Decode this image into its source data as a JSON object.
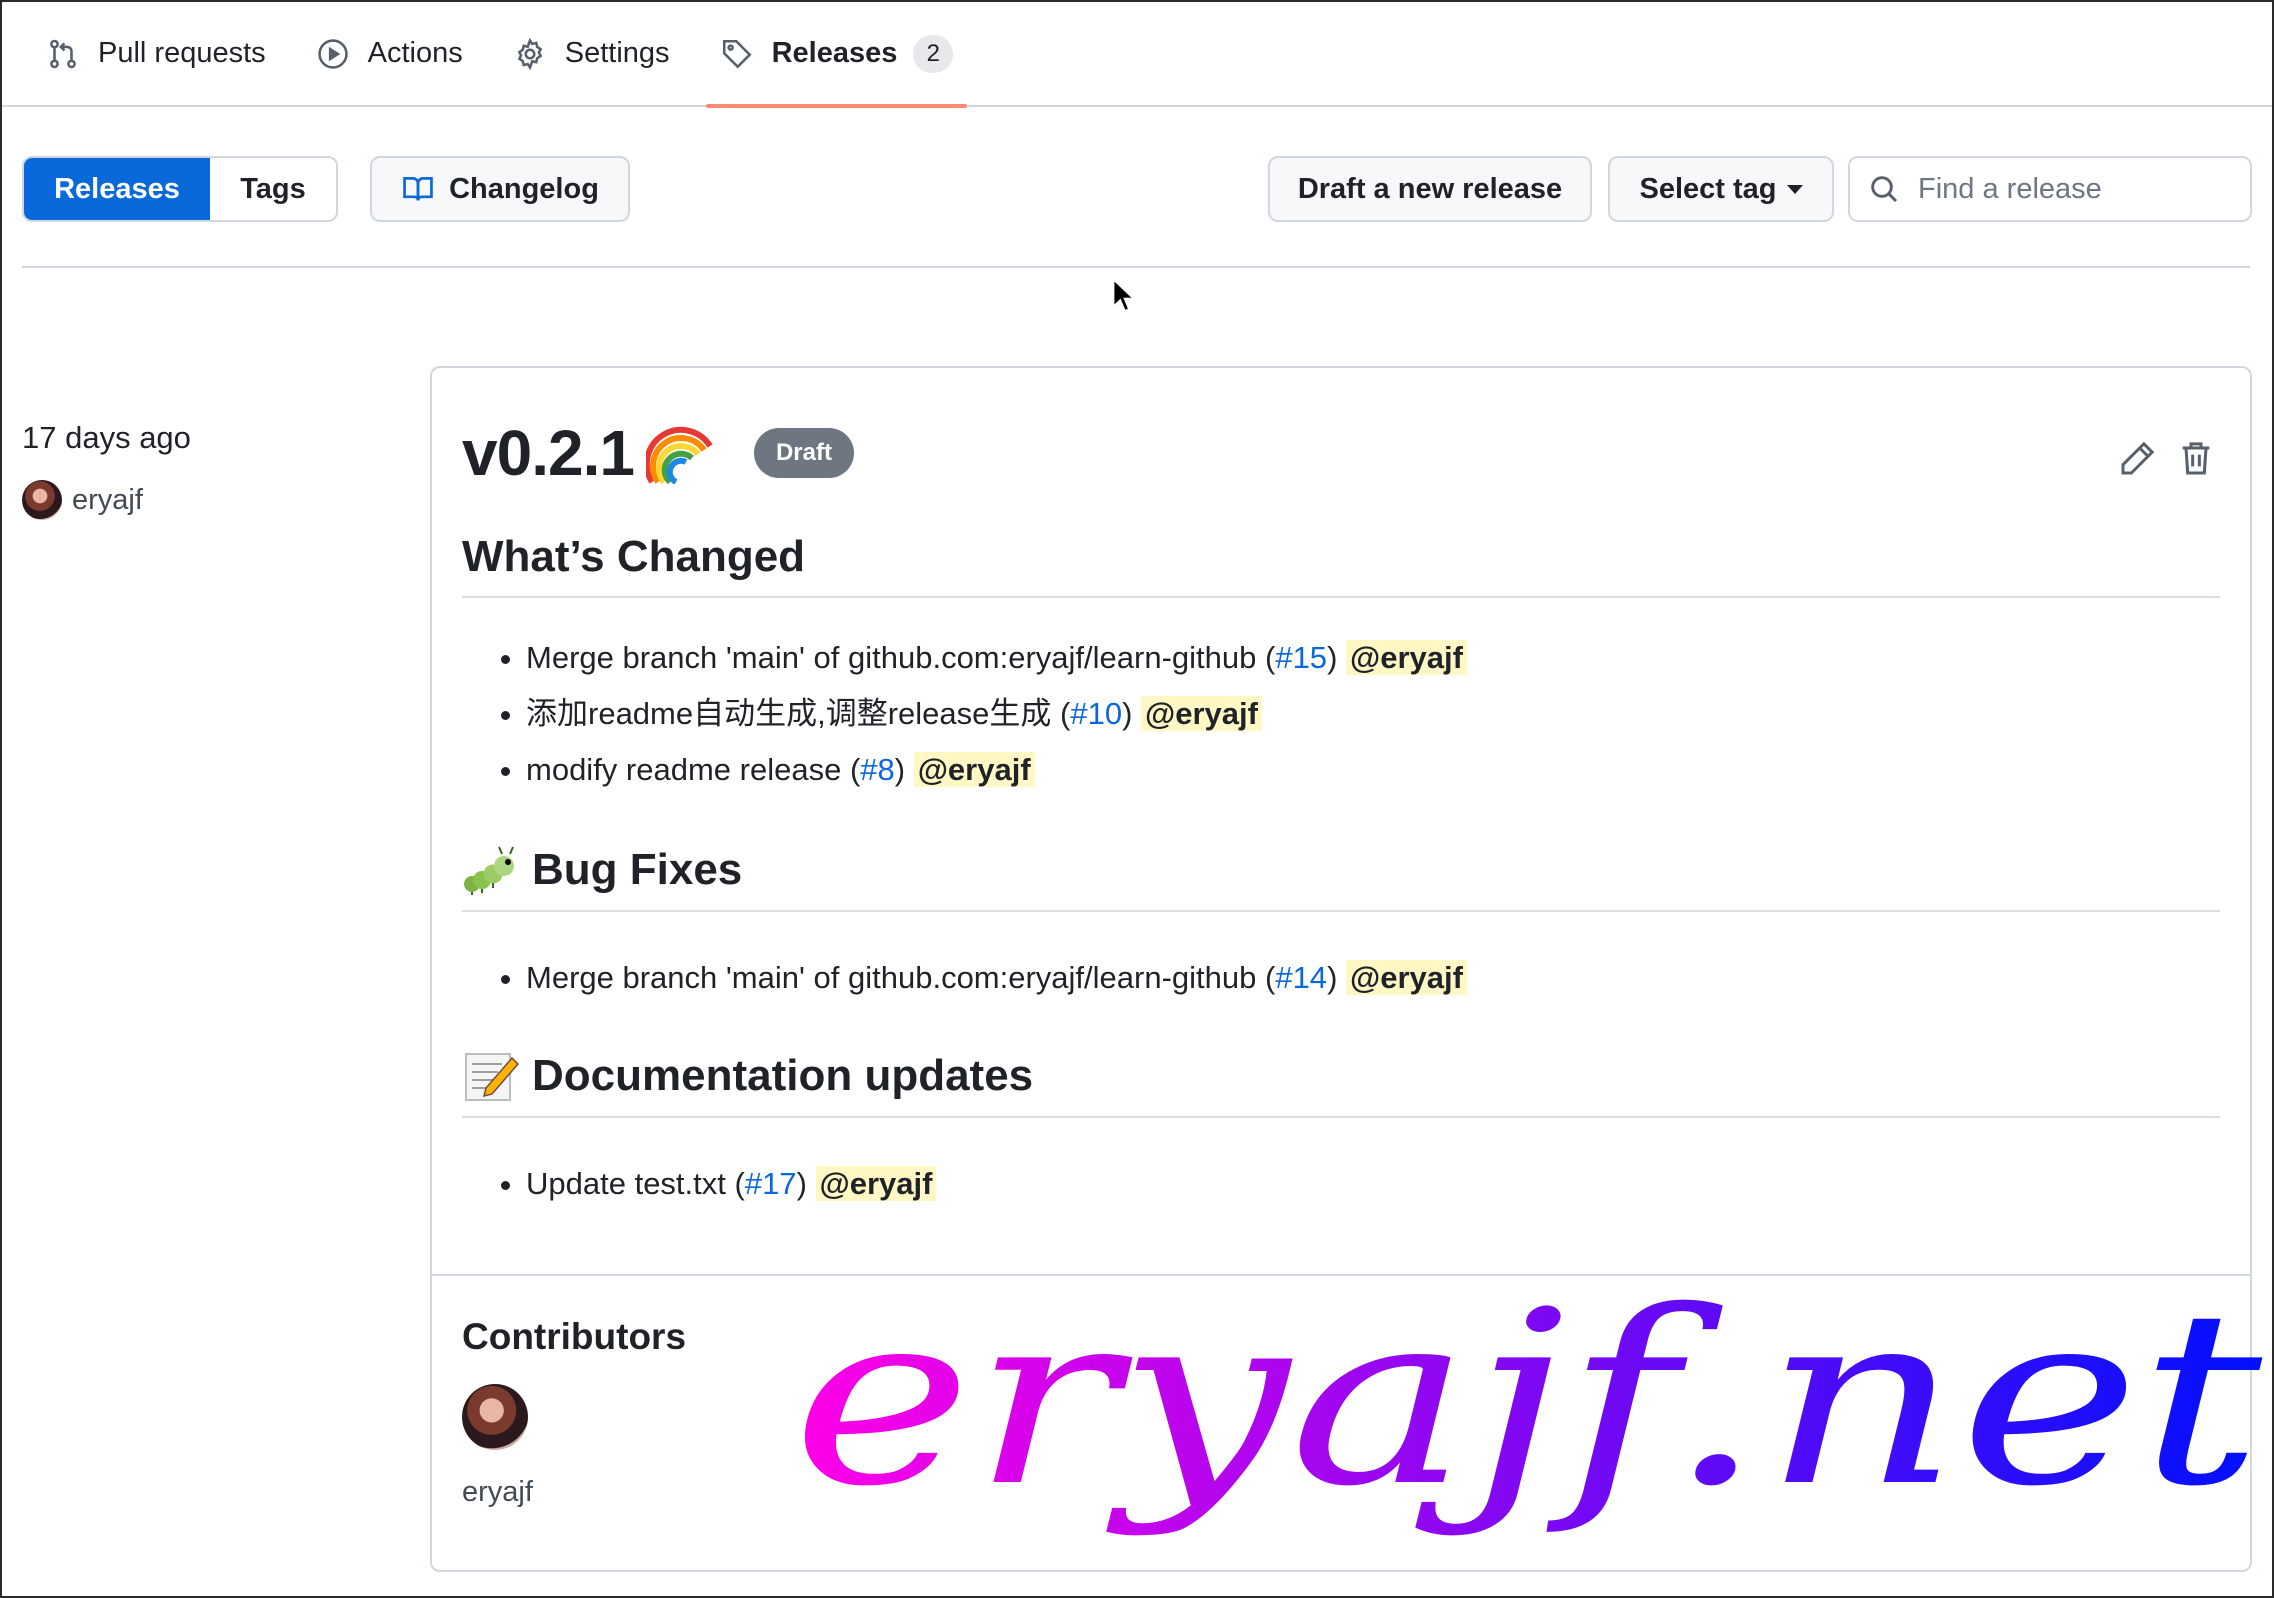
{
  "nav": {
    "tabs": [
      {
        "label": "Pull requests",
        "icon": "git-pull-request-icon"
      },
      {
        "label": "Actions",
        "icon": "play-icon"
      },
      {
        "label": "Settings",
        "icon": "gear-icon"
      },
      {
        "label": "Releases",
        "icon": "tag-icon",
        "count": "2",
        "active": true
      }
    ],
    "active_underline_color": "#fd8c73"
  },
  "toolbar": {
    "releases_label": "Releases",
    "tags_label": "Tags",
    "changelog_label": "Changelog",
    "draft_label": "Draft a new release",
    "select_tag_label": "Select tag",
    "search_placeholder": "Find a release"
  },
  "release": {
    "time_ago": "17 days ago",
    "author": "eryajf",
    "version": "v0.2.1",
    "status_badge": "Draft",
    "sections": [
      {
        "title": "What’s Changed",
        "items": [
          {
            "text": "Merge branch 'main' of github.com:eryajf/learn-github",
            "pr": "#15",
            "mention": "@eryajf"
          },
          {
            "text": "添加readme自动生成,调整release生成",
            "pr": "#10",
            "mention": "@eryajf"
          },
          {
            "text": "modify readme release",
            "pr": "#8",
            "mention": "@eryajf"
          }
        ]
      },
      {
        "title": "Bug Fixes",
        "emoji": "caterpillar-icon",
        "items": [
          {
            "text": "Merge branch 'main' of github.com:eryajf/learn-github",
            "pr": "#14",
            "mention": "@eryajf"
          }
        ]
      },
      {
        "title": "Documentation updates",
        "emoji": "memo-icon",
        "items": [
          {
            "text": "Update test.txt",
            "pr": "#17",
            "mention": "@eryajf"
          }
        ]
      }
    ],
    "contributors_title": "Contributors",
    "contributors": [
      "eryajf"
    ]
  },
  "watermark": "eryajf.net",
  "colors": {
    "primary": "#0969da",
    "mention_bg": "#fff8c5",
    "badge_bg": "#6e7781",
    "watermark_start": "#ff00e6",
    "watermark_end": "#0010ff"
  }
}
